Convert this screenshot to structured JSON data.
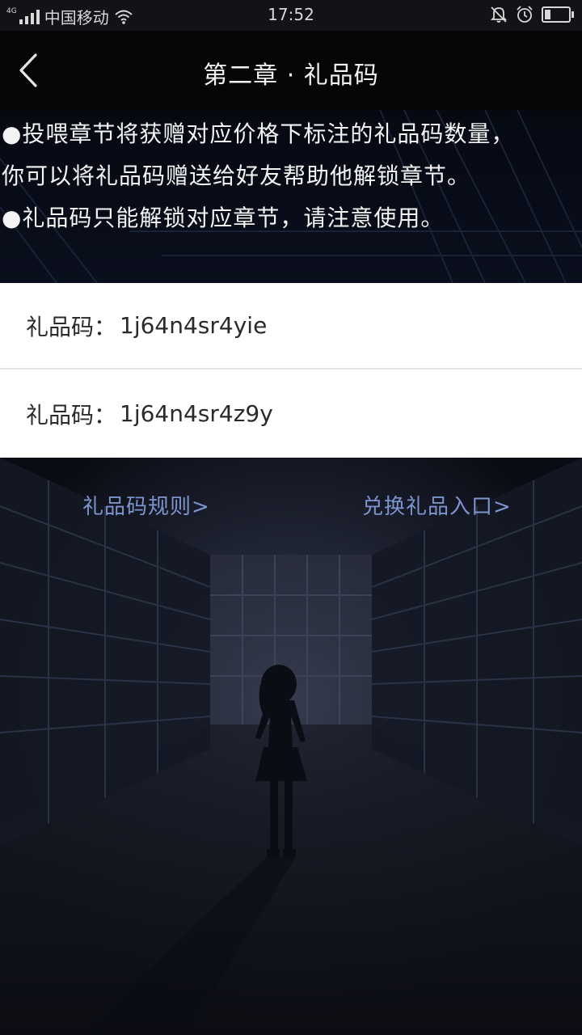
{
  "status_bar": {
    "network": "4G",
    "carrier": "中国移动",
    "time": "17:52"
  },
  "header": {
    "title": "第二章 · 礼品码"
  },
  "notice": {
    "lines": [
      "●投喂章节将获赠对应价格下标注的礼品码数量，",
      "你可以将礼品码赠送给好友帮助他解锁章节。",
      "●礼品码只能解锁对应章节，请注意使用。"
    ]
  },
  "gift_codes": [
    {
      "label": "礼品码：",
      "code": "1j64n4sr4yie"
    },
    {
      "label": "礼品码：",
      "code": "1j64n4sr4z9y"
    }
  ],
  "links": {
    "rules": "礼品码规则>",
    "redeem": "兑换礼品入口>"
  },
  "battery_level": 0.3,
  "colors": {
    "link": "#7d95cf",
    "background": "#06080f"
  }
}
